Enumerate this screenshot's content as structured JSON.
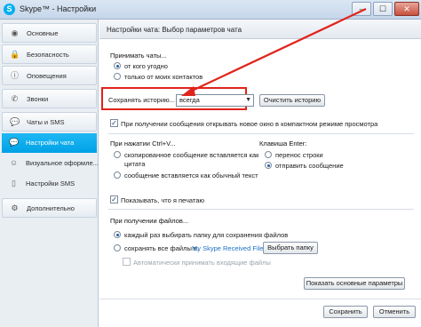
{
  "window": {
    "title": "Skype™ - Настройки",
    "app_icon_letter": "S",
    "minimize_glyph": "–",
    "maximize_glyph": "☐",
    "close_glyph": "✕"
  },
  "sidebar": {
    "items": [
      {
        "label": "Основные",
        "icon": "skype-icon",
        "glyph": "◉"
      },
      {
        "label": "Безопасность",
        "icon": "lock-icon",
        "glyph": "🔒"
      },
      {
        "label": "Оповещения",
        "icon": "info-icon",
        "glyph": "ⓘ"
      },
      {
        "label": "Звонки",
        "icon": "phone-icon",
        "glyph": "✆"
      },
      {
        "label": "Чаты и SMS",
        "icon": "chat-icon",
        "glyph": "💬"
      }
    ],
    "subitems": [
      {
        "label": "Настройки чата",
        "icon": "chat-bubble-icon",
        "glyph": "💬",
        "active": true
      },
      {
        "label": "Визуальное оформле...",
        "icon": "smiley-icon",
        "glyph": "☺",
        "active": false
      },
      {
        "label": "Настройки SMS",
        "icon": "mobile-icon",
        "glyph": "▯",
        "active": false
      }
    ],
    "advanced": {
      "label": "Дополнительно",
      "icon": "gear-icon",
      "glyph": "⚙"
    }
  },
  "header": {
    "title": "Настройки чата: Выбор параметров чата"
  },
  "accept_chats": {
    "title": "Принимать чаты...",
    "options": [
      {
        "label": "от кого угодно",
        "selected": true
      },
      {
        "label": "только от моих контактов",
        "selected": false
      }
    ]
  },
  "history": {
    "label": "Сохранять историю...",
    "value": "всегда",
    "clear_button": "Очистить историю"
  },
  "compact_option": {
    "label": "При получении сообщения открывать новое окно в компактном режиме просмотра",
    "checked": true
  },
  "ctrl_v": {
    "title": "При нажатии Ctrl+V...",
    "options": [
      {
        "label": "скопированное сообщение вставляется как",
        "label2": "цитата",
        "selected": false
      },
      {
        "label": "сообщение вставляется как обычный текст",
        "selected": false
      }
    ]
  },
  "enter_key": {
    "title": "Клавиша Enter:",
    "options": [
      {
        "label": "перенос строки",
        "selected": false
      },
      {
        "label": "отправить сообщение",
        "selected": true
      }
    ]
  },
  "typing_option": {
    "label": "Показывать, что я печатаю",
    "checked": true
  },
  "file_receive": {
    "title": "При получении файлов...",
    "options": [
      {
        "label": "каждый раз выбирать папку для сохранения файлов",
        "selected": true
      },
      {
        "label": "сохранять все файлы в:",
        "folder": "My Skype Received Files",
        "selected": false
      }
    ],
    "choose_folder_button": "Выбрать папку",
    "auto_accept": {
      "label": "Автоматически принимать входящие файлы",
      "checked": false
    }
  },
  "buttons": {
    "basic_params": "Показать основные параметры",
    "save": "Сохранить",
    "cancel": "Отменить"
  },
  "colors": {
    "accent": "#00a2e6",
    "highlight_box": "#e0241b",
    "arrow": "#e0241b"
  }
}
